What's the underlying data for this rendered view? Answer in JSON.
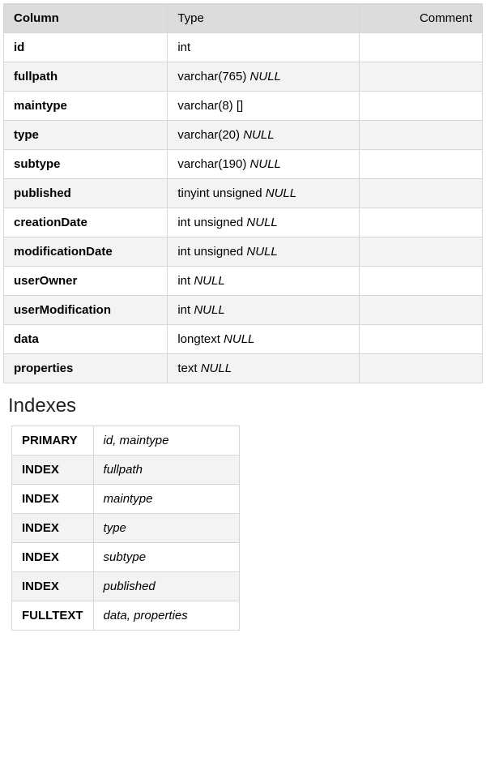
{
  "columnsTable": {
    "headers": {
      "column": "Column",
      "type": "Type",
      "comment": "Comment"
    },
    "rows": [
      {
        "name": "id",
        "typePrefix": "int",
        "typeNull": "",
        "comment": ""
      },
      {
        "name": "fullpath",
        "typePrefix": "varchar(765) ",
        "typeNull": "NULL",
        "comment": ""
      },
      {
        "name": "maintype",
        "typePrefix": "varchar(8) []",
        "typeNull": "",
        "comment": ""
      },
      {
        "name": "type",
        "typePrefix": "varchar(20) ",
        "typeNull": "NULL",
        "comment": ""
      },
      {
        "name": "subtype",
        "typePrefix": "varchar(190) ",
        "typeNull": "NULL",
        "comment": ""
      },
      {
        "name": "published",
        "typePrefix": "tinyint unsigned ",
        "typeNull": "NULL",
        "comment": ""
      },
      {
        "name": "creationDate",
        "typePrefix": "int unsigned ",
        "typeNull": "NULL",
        "comment": ""
      },
      {
        "name": "modificationDate",
        "typePrefix": "int unsigned ",
        "typeNull": "NULL",
        "comment": ""
      },
      {
        "name": "userOwner",
        "typePrefix": "int ",
        "typeNull": "NULL",
        "comment": ""
      },
      {
        "name": "userModification",
        "typePrefix": "int ",
        "typeNull": "NULL",
        "comment": ""
      },
      {
        "name": "data",
        "typePrefix": "longtext ",
        "typeNull": "NULL",
        "comment": ""
      },
      {
        "name": "properties",
        "typePrefix": "text ",
        "typeNull": "NULL",
        "comment": ""
      }
    ]
  },
  "indexesSection": {
    "heading": "Indexes",
    "rows": [
      {
        "type": "PRIMARY",
        "fields": "id, maintype"
      },
      {
        "type": "INDEX",
        "fields": "fullpath"
      },
      {
        "type": "INDEX",
        "fields": "maintype"
      },
      {
        "type": "INDEX",
        "fields": "type"
      },
      {
        "type": "INDEX",
        "fields": "subtype"
      },
      {
        "type": "INDEX",
        "fields": "published"
      },
      {
        "type": "FULLTEXT",
        "fields": "data, properties"
      }
    ]
  }
}
